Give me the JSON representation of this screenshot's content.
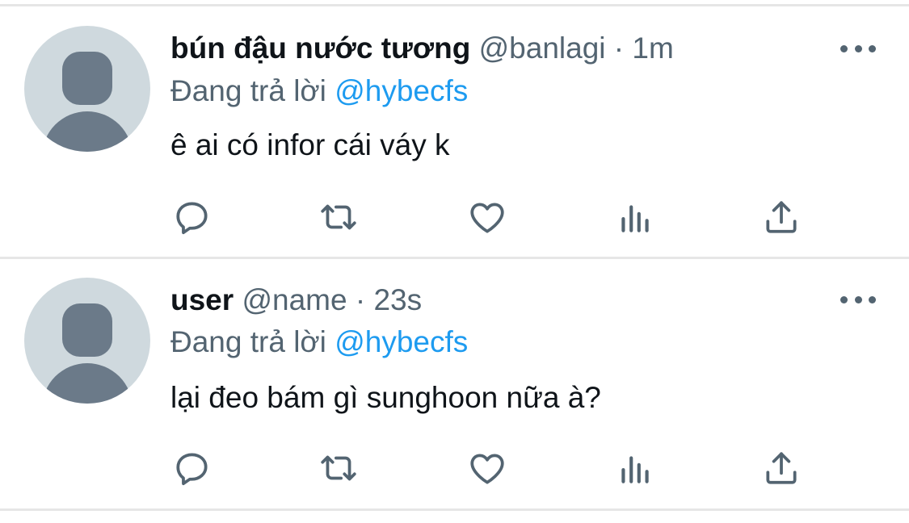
{
  "tweets": [
    {
      "display_name": "bún đậu nước tương",
      "handle": "@banlagi",
      "separator": "·",
      "time": "1m",
      "reply_prefix": "Đang trả lời",
      "reply_to": "@hybecfs",
      "text": "ê ai có infor cái váy k",
      "more_icon": "more-horizontal-icon",
      "actions": [
        "reply-icon",
        "retweet-icon",
        "like-icon",
        "views-icon",
        "share-icon"
      ]
    },
    {
      "display_name": "user",
      "handle": "@name",
      "separator": "·",
      "time": "23s",
      "reply_prefix": "Đang trả lời",
      "reply_to": "@hybecfs",
      "text": "lại đeo bám gì sunghoon nữa à?",
      "more_icon": "more-horizontal-icon",
      "actions": [
        "reply-icon",
        "retweet-icon",
        "like-icon",
        "views-icon",
        "share-icon"
      ]
    }
  ],
  "colors": {
    "text_primary": "#0f1419",
    "text_secondary": "#536471",
    "link": "#1d9bf0",
    "avatar_bg": "#cfd9de",
    "avatar_fg": "#6b7a89",
    "divider": "#e6e6e6"
  }
}
